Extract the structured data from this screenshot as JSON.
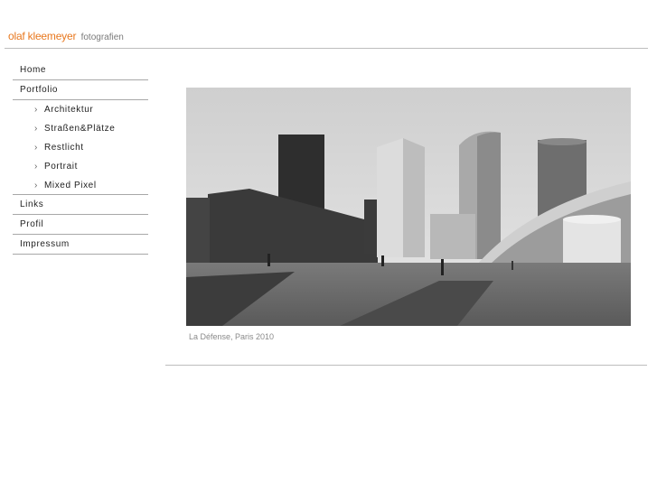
{
  "header": {
    "brand": "olaf kleemeyer",
    "subtitle": "fotografien"
  },
  "nav": {
    "home": "Home",
    "portfolio": "Portfolio",
    "sub_items": [
      "Architektur",
      "Straßen&Plätze",
      "Restlicht",
      "Portrait",
      "Mixed Pixel"
    ],
    "links": "Links",
    "profil": "Profil",
    "impressum": "Impressum",
    "chevron": "›"
  },
  "photo": {
    "caption": "La Défense, Paris 2010"
  },
  "colors": {
    "brand": "#e8781f",
    "rule": "#bdbdbd"
  }
}
